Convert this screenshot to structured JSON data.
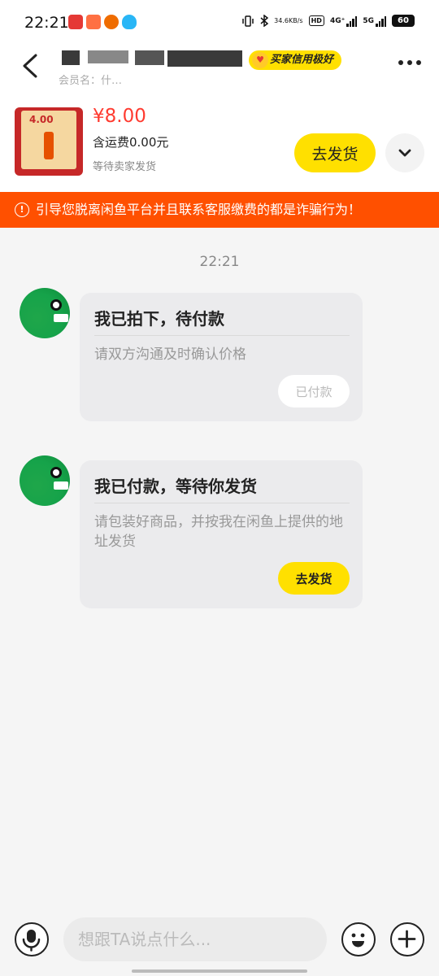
{
  "status_bar": {
    "time": "22:21",
    "net_speed": "34.6",
    "net_unit": "KB/s",
    "hd_label": "HD",
    "net_4g": "4G⁺",
    "net_5g": "5G",
    "battery": "60"
  },
  "header": {
    "title": "买家信用极好",
    "member_label": "会员名：什…",
    "badge_text": "买家信用极好"
  },
  "product": {
    "price": "¥8.00",
    "shipping": "含运费0.00元",
    "status": "等待卖家发货",
    "ship_button": "去发货",
    "thumb_price": "4.00"
  },
  "warning": {
    "text": "引导您脱离闲鱼平台并且联系客服缴费的都是诈骗行为！"
  },
  "chat": {
    "timestamp": "22:21",
    "messages": [
      {
        "title": "我已拍下，待付款",
        "body": "请双方沟通及时确认价格",
        "button": "已付款"
      },
      {
        "title": "我已付款，等待你发货",
        "body": "请包装好商品，并按我在闲鱼上提供的地址发货",
        "button": "去发货"
      }
    ]
  },
  "input": {
    "placeholder": "想跟TA说点什么..."
  },
  "colors": {
    "accent_yellow": "#ffe000",
    "warning_orange": "#ff5000",
    "price_red": "#ff3b30",
    "avatar_green": "#16a34a"
  }
}
